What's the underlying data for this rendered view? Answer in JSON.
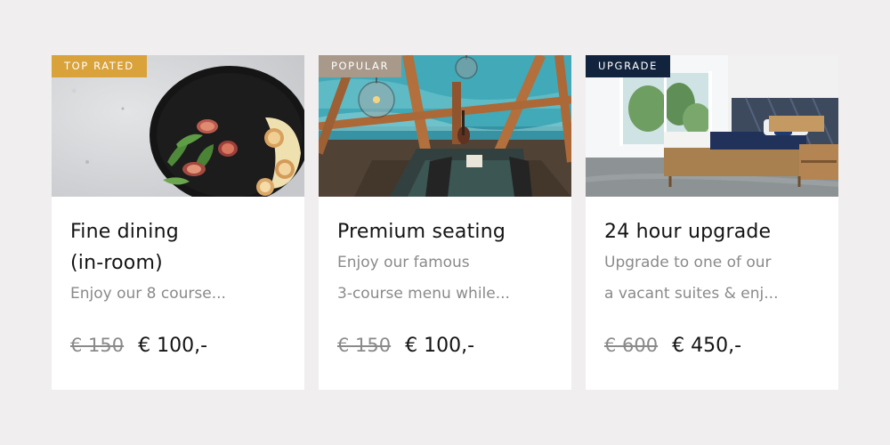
{
  "colors": {
    "page_background": "#f0eeee",
    "card_background": "#ffffff",
    "badge_top_rated": "#d9a23a",
    "badge_popular": "#a8998a",
    "badge_upgrade": "#12233d",
    "muted_text": "#8a8a8a",
    "title_text": "#141414"
  },
  "cards": [
    {
      "badge": "TOP RATED",
      "image": "fine-dining-plate-image",
      "title_line1": "Fine dining",
      "title_line2": "(in-room)",
      "desc_line1": "Enjoy our 8 course...",
      "desc_line2": "",
      "price_old": "€ 150",
      "price_new": "€ 100,-"
    },
    {
      "badge": "POPULAR",
      "image": "premium-seating-image",
      "title_line1": "Premium seating",
      "title_line2": "",
      "desc_line1": "Enjoy our famous",
      "desc_line2": "3-course menu while...",
      "price_old": "€ 150",
      "price_new": "€ 100,-"
    },
    {
      "badge": "UPGRADE",
      "image": "suite-bedroom-image",
      "title_line1": "24 hour upgrade",
      "title_line2": "",
      "desc_line1": "Upgrade to one of our",
      "desc_line2": "a vacant suites & enj...",
      "price_old": "€ 600",
      "price_new": "€ 450,-"
    }
  ]
}
